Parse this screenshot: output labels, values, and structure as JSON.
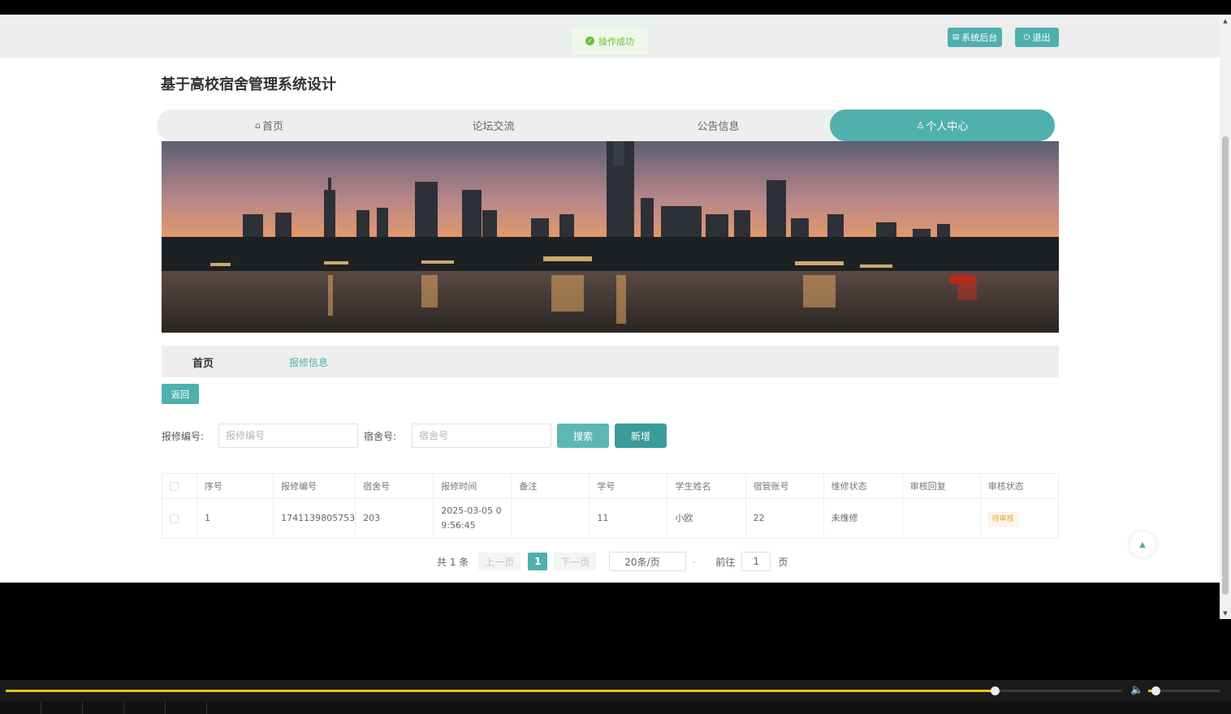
{
  "toast": {
    "text": "操作成功"
  },
  "header": {
    "admin_label": "系统后台",
    "logout_label": "退出"
  },
  "site_title": "基于高校宿舍管理系统设计",
  "nav": [
    {
      "label": "首页",
      "icon": "home-icon"
    },
    {
      "label": "论坛交流"
    },
    {
      "label": "公告信息"
    },
    {
      "label": "个人中心",
      "icon": "user-icon",
      "active": true
    }
  ],
  "breadcrumb": {
    "home": "首页",
    "current": "报修信息"
  },
  "back_label": "返回",
  "filters": {
    "repair_no_label": "报修编号:",
    "repair_no_placeholder": "报修编号",
    "dorm_no_label": "宿舍号:",
    "dorm_no_placeholder": "宿舍号",
    "search_label": "搜索",
    "add_label": "新增"
  },
  "table": {
    "columns": [
      "序号",
      "报修编号",
      "宿舍号",
      "报修时间",
      "备注",
      "学号",
      "学生姓名",
      "宿管账号",
      "维修状态",
      "审核回复",
      "审核状态"
    ],
    "rows": [
      {
        "index": "1",
        "repair_no": "1741139805753",
        "dorm_no": "203",
        "time": "2025-03-05 09:56:45",
        "remark": "",
        "student_no": "11",
        "student_name": "小欧",
        "manager_account": "22",
        "repair_status": "未维修",
        "reply": "",
        "audit_status": "待审核"
      }
    ]
  },
  "pager": {
    "total": "共 1 条",
    "prev": "上一页",
    "current": "1",
    "next": "下一页",
    "page_size": "20条/页",
    "goto_label": "前往",
    "goto_value": "1",
    "page_suffix": "页"
  },
  "media": {
    "progress": 0.886,
    "volume": 0.1
  },
  "colors": {
    "accent": "#4fb0ae",
    "success": "#67c23a",
    "warning": "#e6a23c"
  }
}
